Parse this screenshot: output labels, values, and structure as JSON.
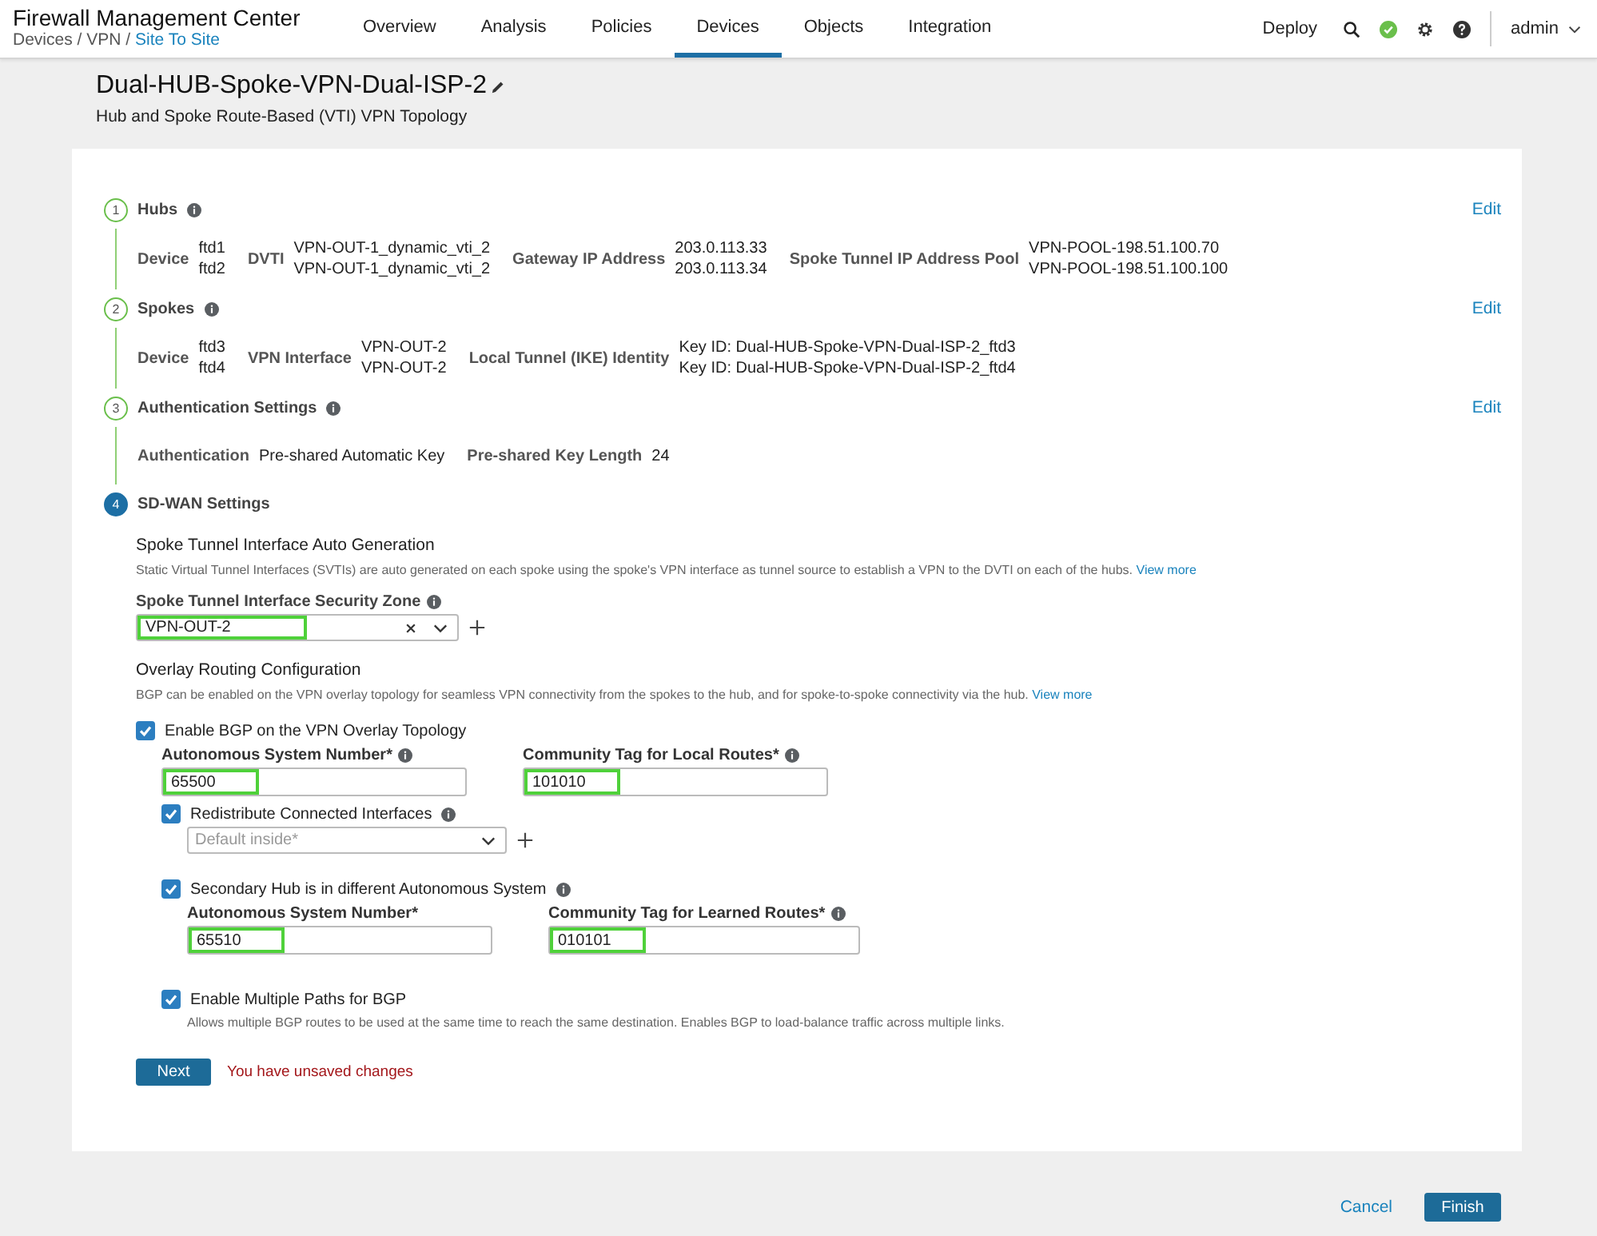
{
  "header": {
    "title": "Firewall Management Center",
    "breadcrumb": {
      "path": "Devices / VPN /",
      "current": "Site To Site"
    },
    "tabs": [
      {
        "label": "Overview",
        "selected": false
      },
      {
        "label": "Analysis",
        "selected": false
      },
      {
        "label": "Policies",
        "selected": false
      },
      {
        "label": "Devices",
        "selected": true
      },
      {
        "label": "Objects",
        "selected": false
      },
      {
        "label": "Integration",
        "selected": false
      }
    ],
    "deploy": "Deploy",
    "user": "admin"
  },
  "page": {
    "title": "Dual-HUB-Spoke-VPN-Dual-ISP-2",
    "subtitle": "Hub and Spoke Route-Based (VTI) VPN Topology"
  },
  "steps": [
    {
      "number": "1",
      "title": "Hubs",
      "active": false,
      "edit": "Edit",
      "details": [
        {
          "label": "Device",
          "values": [
            "ftd1",
            "ftd2"
          ]
        },
        {
          "label": "DVTI",
          "values": [
            "VPN-OUT-1_dynamic_vti_2",
            "VPN-OUT-1_dynamic_vti_2"
          ]
        },
        {
          "label": "Gateway IP Address",
          "values": [
            "203.0.113.33",
            "203.0.113.34"
          ]
        },
        {
          "label": "Spoke Tunnel IP Address Pool",
          "values": [
            "VPN-POOL-198.51.100.70",
            "VPN-POOL-198.51.100.100"
          ]
        }
      ]
    },
    {
      "number": "2",
      "title": "Spokes",
      "active": false,
      "edit": "Edit",
      "details": [
        {
          "label": "Device",
          "values": [
            "ftd3",
            "ftd4"
          ]
        },
        {
          "label": "VPN Interface",
          "values": [
            "VPN-OUT-2",
            "VPN-OUT-2"
          ]
        },
        {
          "label": "Local Tunnel (IKE) Identity",
          "values": [
            "Key ID: Dual-HUB-Spoke-VPN-Dual-ISP-2_ftd3",
            "Key ID: Dual-HUB-Spoke-VPN-Dual-ISP-2_ftd4"
          ]
        }
      ]
    },
    {
      "number": "3",
      "title": "Authentication Settings",
      "active": false,
      "edit": "Edit",
      "details": [
        {
          "label": "Authentication",
          "values": [
            "Pre-shared Automatic Key"
          ]
        },
        {
          "label": "Pre-shared Key Length",
          "values": [
            "24"
          ]
        }
      ]
    },
    {
      "number": "4",
      "title": "SD-WAN Settings",
      "active": true
    }
  ],
  "sdwan": {
    "auto_gen": {
      "heading": "Spoke Tunnel Interface Auto Generation",
      "description": "Static Virtual Tunnel Interfaces (SVTIs) are auto generated on each spoke using the spoke's VPN interface as tunnel source to establish a VPN to the DVTI on each of the hubs.",
      "link": "View more"
    },
    "zone": {
      "label": "Spoke Tunnel Interface Security Zone",
      "value": "VPN-OUT-2",
      "highlighted": true
    },
    "overlay": {
      "heading": "Overlay Routing Configuration",
      "description": "BGP can be enabled on the VPN overlay topology for seamless VPN connectivity from the spokes to the hub, and for spoke-to-spoke connectivity via the hub.",
      "link": "View more"
    },
    "enable_bgp": {
      "label": "Enable BGP on the VPN Overlay Topology",
      "checked": true
    },
    "as_number": {
      "label": "Autonomous System Number*",
      "info": true,
      "value": "65500",
      "highlighted": true
    },
    "local_tag": {
      "label": "Community Tag for Local Routes*",
      "info": true,
      "value": "101010",
      "highlighted": true
    },
    "redistribute": {
      "label": "Redistribute Connected Interfaces",
      "checked": true,
      "placeholder": "Default inside*"
    },
    "secondary": {
      "label": "Secondary Hub is in different Autonomous System",
      "checked": true
    },
    "as_number_2": {
      "label": "Autonomous System Number*",
      "info": false,
      "value": "65510",
      "highlighted": true
    },
    "learned_tag": {
      "label": "Community Tag for Learned Routes*",
      "info": true,
      "value": "010101",
      "highlighted": true
    },
    "multipath": {
      "label": "Enable Multiple Paths for BGP",
      "checked": true,
      "description": "Allows multiple BGP routes to be used at the same time to reach the same destination. Enables BGP to load-balance traffic across multiple links."
    },
    "next": "Next",
    "unsaved": "You have unsaved changes"
  },
  "footer": {
    "cancel": "Cancel",
    "finish": "Finish"
  }
}
